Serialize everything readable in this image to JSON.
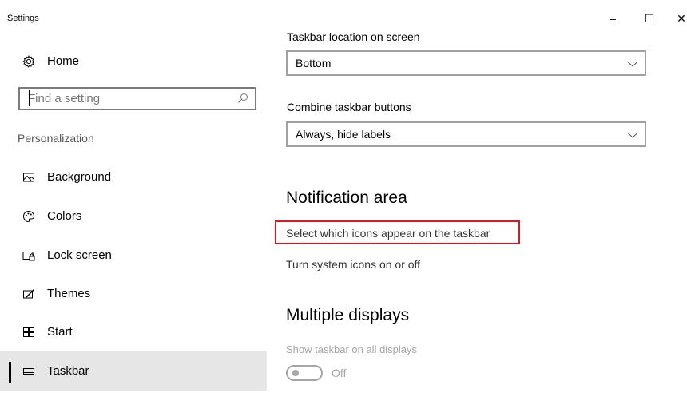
{
  "window": {
    "title": "Settings",
    "minimize_glyph": "–",
    "maximize_glyph": "☐",
    "close_glyph": "✕"
  },
  "sidebar": {
    "home": {
      "label": "Home",
      "icon": "gear-icon"
    },
    "search": {
      "placeholder": "Find a setting",
      "value": "",
      "icon": "search-icon"
    },
    "section_label": "Personalization",
    "items": [
      {
        "label": "Background",
        "icon": "picture-icon",
        "selected": false
      },
      {
        "label": "Colors",
        "icon": "palette-icon",
        "selected": false
      },
      {
        "label": "Lock screen",
        "icon": "lock-screen-icon",
        "selected": false
      },
      {
        "label": "Themes",
        "icon": "themes-icon",
        "selected": false
      },
      {
        "label": "Start",
        "icon": "start-icon",
        "selected": false
      },
      {
        "label": "Taskbar",
        "icon": "taskbar-icon",
        "selected": true
      }
    ]
  },
  "main": {
    "taskbar_location": {
      "label": "Taskbar location on screen",
      "value": "Bottom"
    },
    "combine_buttons": {
      "label": "Combine taskbar buttons",
      "value": "Always, hide labels"
    },
    "notification_area": {
      "heading": "Notification area",
      "select_icons_link": "Select which icons appear on the taskbar",
      "system_icons_link": "Turn system icons on or off"
    },
    "multiple_displays": {
      "heading": "Multiple displays",
      "show_on_all_label": "Show taskbar on all displays",
      "toggle_state": "Off",
      "toggle_on": false,
      "disabled": true
    }
  },
  "colors": {
    "highlight_border": "#e0181e",
    "selected_bg": "#e6e6e6",
    "disabled_text": "#a6a6a6"
  }
}
